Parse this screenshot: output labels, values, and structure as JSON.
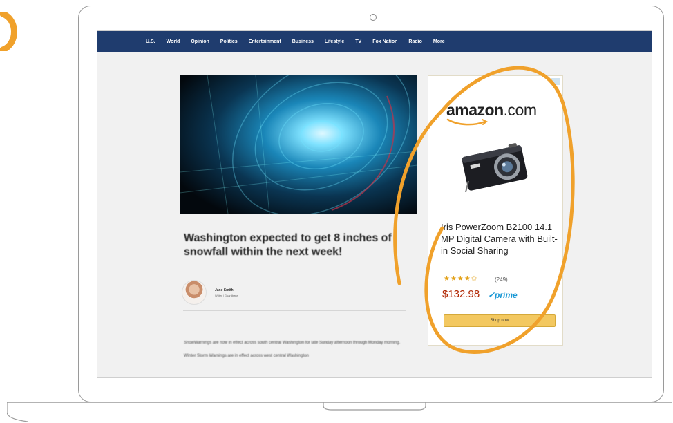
{
  "nav": {
    "items": [
      "U.S.",
      "World",
      "Opinion",
      "Politics",
      "Entertainment",
      "Business",
      "Lifestyle",
      "TV",
      "Fox Nation",
      "Radio",
      "More"
    ]
  },
  "article": {
    "headline": "Washington expected to get 8 inches of snowfall within the next week!",
    "author_name": "Jane Smith",
    "author_role": "Writer | Guardbase",
    "body": "SnowWarnings are now in effect across south central Washington for late Sunday afternoon through Monday morning. Winter Storm Warnings are in effect across west central Washington"
  },
  "ad": {
    "logo_text": "amazon",
    "logo_suffix": ".com",
    "product_title": "Iris PowerZoom B2100 14.1 MP Digital Camera with Built-in Social Sharing",
    "stars": "★★★★✩",
    "rating": 4.5,
    "reviews": "(249)",
    "price": "$132.98",
    "prime": "✓prime",
    "button_label": "Shop now"
  },
  "colors": {
    "nav_bg": "#1f3c6e",
    "accent_orange": "#f0a12b",
    "price_red": "#b12704",
    "prime_blue": "#1a98d5",
    "button_yellow": "#f3c860"
  }
}
